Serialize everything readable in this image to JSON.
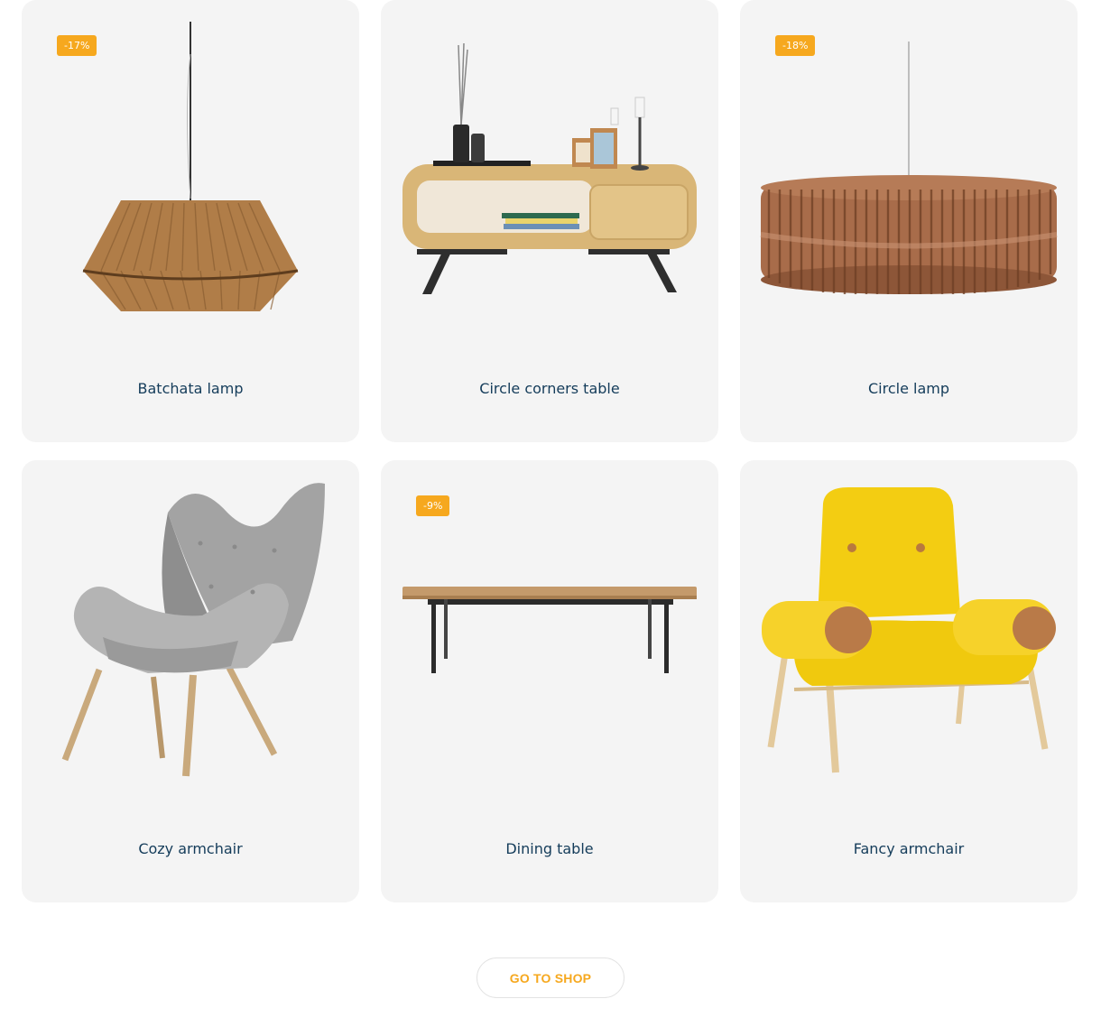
{
  "products": [
    {
      "name": "Batchata lamp",
      "discount": "-17%",
      "image": "pendant-lamp-image"
    },
    {
      "name": "Circle corners table",
      "discount": "",
      "image": "console-table-image"
    },
    {
      "name": "Circle lamp",
      "discount": "-18%",
      "image": "circle-pendant-lamp-image"
    },
    {
      "name": "Cozy armchair",
      "discount": "",
      "image": "grey-armchair-image"
    },
    {
      "name": "Dining table",
      "discount": "-9%",
      "image": "dining-table-image"
    },
    {
      "name": "Fancy armchair",
      "discount": "",
      "image": "yellow-armchair-image"
    }
  ],
  "cta": {
    "label": "GO TO SHOP"
  },
  "colors": {
    "badge": "#f6a81e",
    "title": "#143c5a",
    "card_bg": "#f4f4f4"
  }
}
